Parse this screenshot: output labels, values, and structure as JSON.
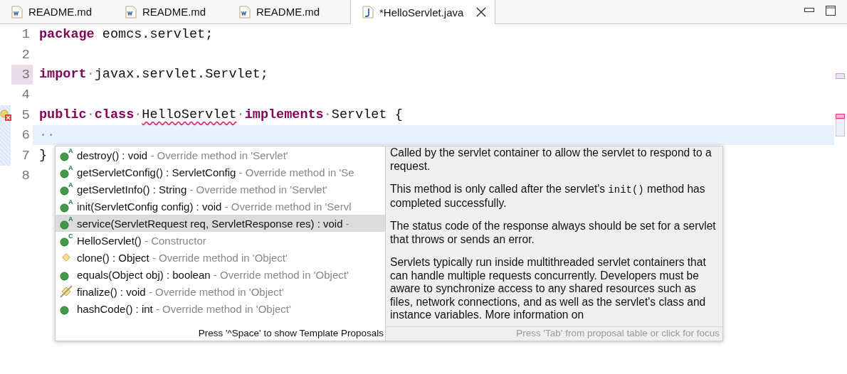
{
  "tabs": [
    {
      "label": "README.md",
      "kind": "word",
      "selected": false
    },
    {
      "label": "README.md",
      "kind": "word",
      "selected": false
    },
    {
      "label": "README.md",
      "kind": "word",
      "selected": false
    },
    {
      "label": "*HelloServlet.java",
      "kind": "java",
      "selected": true
    }
  ],
  "editor": {
    "lines": [
      {
        "number": "1",
        "current": false,
        "changed": false,
        "tokens": [
          {
            "text": "package",
            "kind": "keyword"
          },
          {
            "text": " eomcs.servlet;",
            "kind": "plain"
          }
        ]
      },
      {
        "number": "2",
        "current": false,
        "changed": false
      },
      {
        "number": "3",
        "current": false,
        "changed": true,
        "tokens": [
          {
            "text": "import",
            "kind": "keyword"
          },
          {
            "text": "·",
            "kind": "space"
          },
          {
            "text": "javax.servlet.Servlet;",
            "kind": "plain"
          }
        ]
      },
      {
        "number": "4",
        "current": false,
        "changed": false
      },
      {
        "number": "5",
        "current": false,
        "changed": false,
        "error": true,
        "tokens": [
          {
            "text": "public",
            "kind": "keyword"
          },
          {
            "text": "·",
            "kind": "space"
          },
          {
            "text": "class",
            "kind": "keyword"
          },
          {
            "text": "·",
            "kind": "space"
          },
          {
            "text": "HelloServlet",
            "kind": "error"
          },
          {
            "text": "·",
            "kind": "space"
          },
          {
            "text": "implements",
            "kind": "keyword"
          },
          {
            "text": "·",
            "kind": "space"
          },
          {
            "text": "Servlet {",
            "kind": "plain"
          }
        ]
      },
      {
        "number": "6",
        "current": true,
        "changed": false,
        "tokens": [
          {
            "text": "··",
            "kind": "space"
          }
        ]
      },
      {
        "number": "7",
        "current": false,
        "changed": false,
        "tokens": [
          {
            "text": "}",
            "kind": "plain"
          }
        ]
      },
      {
        "number": "8",
        "current": false,
        "changed": false
      }
    ]
  },
  "proposals": {
    "items": [
      {
        "kind": "abstract",
        "badge": "A",
        "label": "destroy() : void",
        "detail": "- Override method in 'Servlet'",
        "selected": false
      },
      {
        "kind": "abstract",
        "badge": "A",
        "label": "getServletConfig() : ServletConfig",
        "detail": "- Override method in 'Se",
        "selected": false
      },
      {
        "kind": "abstract",
        "badge": "A",
        "label": "getServletInfo() : String",
        "detail": "- Override method in 'Servlet'",
        "selected": false
      },
      {
        "kind": "abstract",
        "badge": "A",
        "label": "init(ServletConfig config) : void",
        "detail": "- Override method in 'Servl",
        "selected": false
      },
      {
        "kind": "abstract",
        "badge": "A",
        "label": "service(ServletRequest req, ServletResponse res) : void",
        "detail": "-",
        "selected": true
      },
      {
        "kind": "constructor",
        "badge": "C",
        "label": "HelloServlet()",
        "detail": "- Constructor",
        "selected": false
      },
      {
        "kind": "protected",
        "label": "clone() : Object",
        "detail": "- Override method in 'Object'",
        "selected": false
      },
      {
        "kind": "public",
        "label": "equals(Object obj) : boolean",
        "detail": "- Override method in 'Object'",
        "selected": false
      },
      {
        "kind": "deprecated",
        "label": "finalize() : void",
        "detail": "- Override method in 'Object'",
        "selected": false
      },
      {
        "kind": "public",
        "label": "hashCode() : int",
        "detail": "- Override method in 'Object'",
        "selected": false
      }
    ],
    "hint": "Press '^Space' to show Template Proposals"
  },
  "documentation": {
    "paragraphs": [
      [
        {
          "text": "Called by the servlet container to allow the servlet to respond to a request.",
          "code": false
        }
      ],
      [
        {
          "text": "This method is only called after the servlet's ",
          "code": false
        },
        {
          "text": "init()",
          "code": true
        },
        {
          "text": " method has completed successfully.",
          "code": false
        }
      ],
      [
        {
          "text": "The status code of the response always should be set for a servlet that throws or sends an error.",
          "code": false
        }
      ],
      [
        {
          "text": "Servlets typically run inside multithreaded servlet containers that can handle multiple requests concurrently. Developers must be aware to synchronize access to any shared resources such as files, network connections, and as well as the servlet's class and instance variables. More information on",
          "code": false
        }
      ]
    ],
    "hint": "Press 'Tab' from proposal table or click for focus"
  }
}
